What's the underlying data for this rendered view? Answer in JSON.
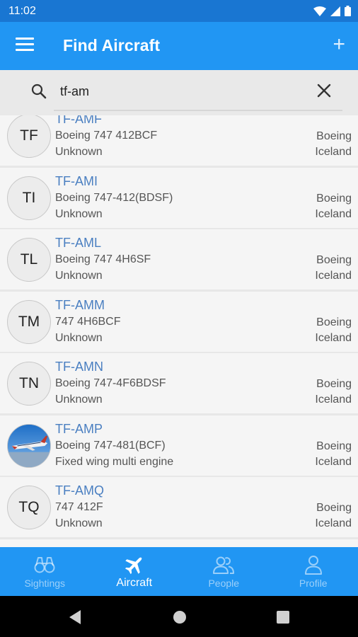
{
  "status_bar": {
    "time": "11:02"
  },
  "app_bar": {
    "title": "Find Aircraft",
    "add_symbol": "+"
  },
  "search": {
    "value": "tf-am",
    "placeholder": ""
  },
  "aircraft": [
    {
      "initials": "TF",
      "registration": "TF-AMF",
      "model": "Boeing 747 412BCF",
      "category": "Unknown",
      "manufacturer": "Boeing",
      "country": "Iceland",
      "photo": false
    },
    {
      "initials": "TI",
      "registration": "TF-AMI",
      "model": "Boeing 747-412(BDSF)",
      "category": "Unknown",
      "manufacturer": "Boeing",
      "country": "Iceland",
      "photo": false
    },
    {
      "initials": "TL",
      "registration": "TF-AML",
      "model": "Boeing 747 4H6SF",
      "category": "Unknown",
      "manufacturer": "Boeing",
      "country": "Iceland",
      "photo": false
    },
    {
      "initials": "TM",
      "registration": "TF-AMM",
      "model": "747 4H6BCF",
      "category": "Unknown",
      "manufacturer": "Boeing",
      "country": "Iceland",
      "photo": false
    },
    {
      "initials": "TN",
      "registration": "TF-AMN",
      "model": "Boeing 747-4F6BDSF",
      "category": "Unknown",
      "manufacturer": "Boeing",
      "country": "Iceland",
      "photo": false
    },
    {
      "initials": "",
      "registration": "TF-AMP",
      "model": "Boeing 747-481(BCF)",
      "category": "Fixed wing multi engine",
      "manufacturer": "Boeing",
      "country": "Iceland",
      "photo": true
    },
    {
      "initials": "TQ",
      "registration": "TF-AMQ",
      "model": "747 412F",
      "category": "Unknown",
      "manufacturer": "Boeing",
      "country": "Iceland",
      "photo": false
    }
  ],
  "bottom_nav": {
    "items": [
      {
        "label": "Sightings",
        "icon": "binoculars-icon",
        "active": false
      },
      {
        "label": "Aircraft",
        "icon": "airplane-icon",
        "active": true
      },
      {
        "label": "People",
        "icon": "people-icon",
        "active": false
      },
      {
        "label": "Profile",
        "icon": "person-icon",
        "active": false
      }
    ]
  },
  "colors": {
    "primary": "#2196f3",
    "status_bar": "#1976d2",
    "link": "#4a7fc1"
  }
}
